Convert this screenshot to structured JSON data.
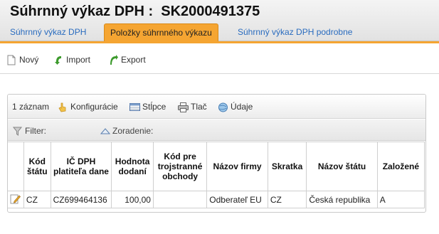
{
  "header": {
    "title": "Súhrnný výkaz DPH :  SK2000491375",
    "tabs": [
      {
        "label": "Súhrnný výkaz DPH",
        "active": false
      },
      {
        "label": "Položky súhrnného výkazu",
        "active": true
      },
      {
        "label": "Súhrnný výkaz DPH podrobne",
        "active": false
      }
    ]
  },
  "toolbar": {
    "new_label": "Nový",
    "import_label": "Import",
    "export_label": "Export"
  },
  "grid": {
    "record_count": "1 záznam",
    "config_label": "Konfigurácie",
    "columns_label": "Stĺpce",
    "print_label": "Tlač",
    "data_label": "Údaje",
    "filter_label": "Filter:",
    "sort_label": "Zoradenie:",
    "columns": [
      "Kód štátu",
      "IČ DPH platiteľa dane",
      "Hodnota dodaní",
      "Kód pre trojstranné obchody",
      "Názov firmy",
      "Skratka",
      "Názov štátu",
      "Založené"
    ],
    "rows": [
      [
        "CZ",
        "CZ699464136",
        "100,00",
        "",
        "Odberateľ EU",
        "CZ",
        "Česká republika",
        "A"
      ]
    ]
  },
  "colors": {
    "accent": "#f5a532",
    "link": "#2a6cbf"
  }
}
